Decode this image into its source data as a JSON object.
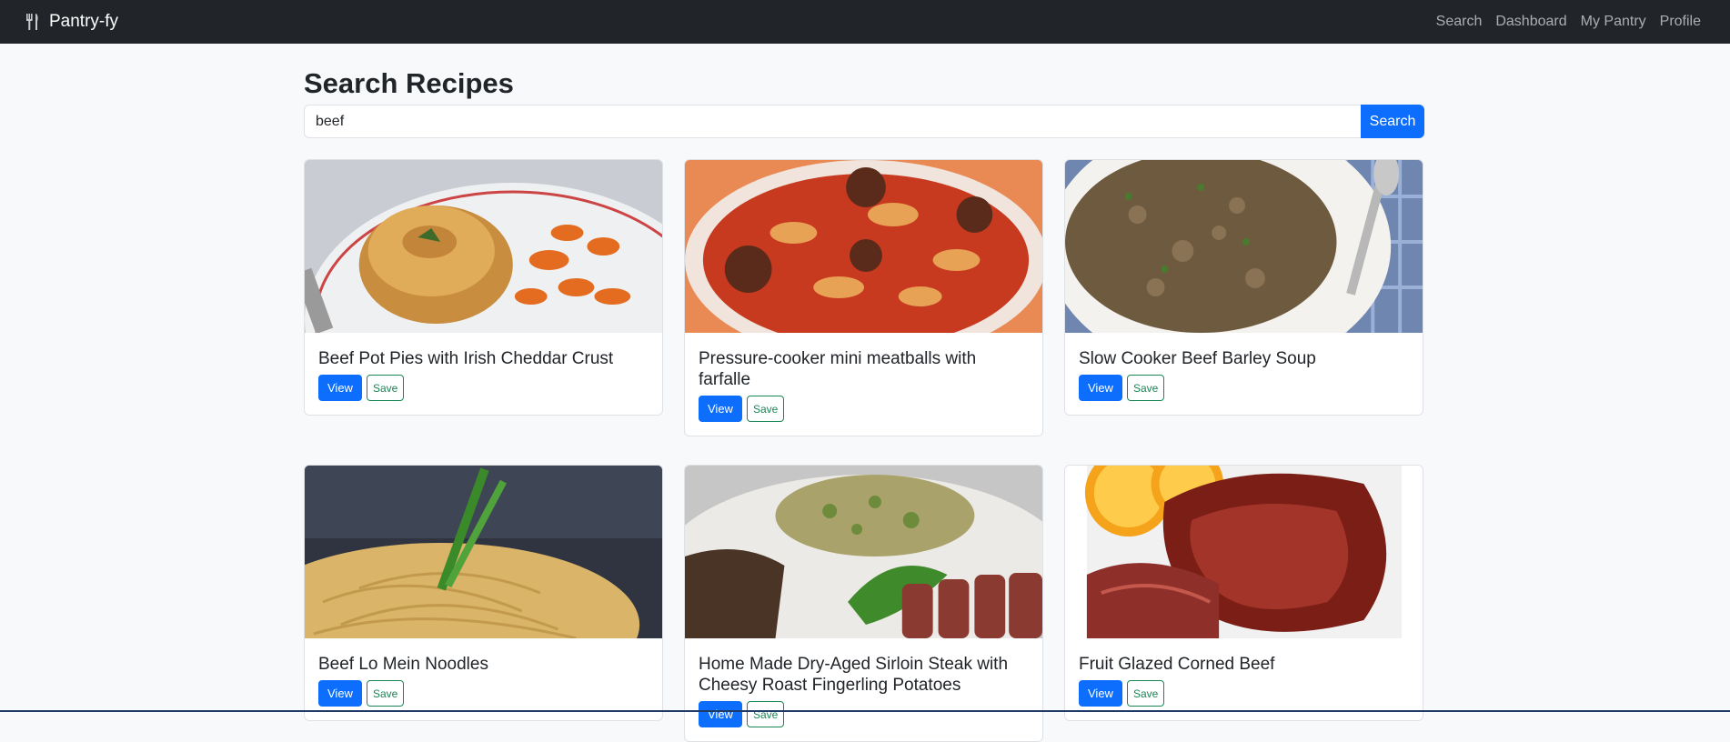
{
  "navbar": {
    "brand": "Pantry-fy",
    "brand_icon": "utensils-icon",
    "links": [
      "Search",
      "Dashboard",
      "My Pantry",
      "Profile"
    ]
  },
  "page": {
    "title": "Search Recipes"
  },
  "search": {
    "value": "beef",
    "button_label": "Search"
  },
  "cards": [
    {
      "title": "Beef Pot Pies with Irish Cheddar Crust",
      "view_label": "View",
      "save_label": "Save",
      "image": "pot-pie-photo"
    },
    {
      "title": "Pressure-cooker mini meatballs with farfalle",
      "view_label": "View",
      "save_label": "Save",
      "image": "meatball-pasta-photo"
    },
    {
      "title": "Slow Cooker Beef Barley Soup",
      "view_label": "View",
      "save_label": "Save",
      "image": "barley-soup-photo"
    },
    {
      "title": "Beef Lo Mein Noodles",
      "view_label": "View",
      "save_label": "Save",
      "image": "lo-mein-photo"
    },
    {
      "title": "Home Made Dry-Aged Sirloin Steak with Cheesy Roast Fingerling Potatoes",
      "view_label": "View",
      "save_label": "Save",
      "image": "sirloin-steak-photo"
    },
    {
      "title": "Fruit Glazed Corned Beef",
      "view_label": "View",
      "save_label": "Save",
      "image": "corned-beef-photo"
    }
  ],
  "colors": {
    "navbar_bg": "#212529",
    "primary": "#0d6efd",
    "success": "#198754",
    "page_bg": "#f8f9fa"
  }
}
